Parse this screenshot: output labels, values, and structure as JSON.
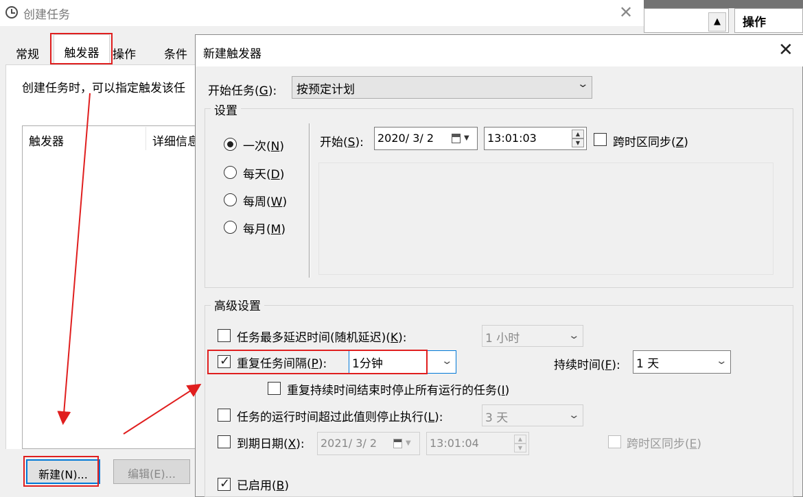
{
  "background_window": {
    "title": "创建任务",
    "close_glyph": "✕",
    "tabs": [
      "常规",
      "触发器",
      "操作",
      "条件"
    ],
    "description": "创建任务时，可以指定触发该任",
    "list_columns": [
      "触发器",
      "详细信息"
    ],
    "buttons": {
      "new": "新建(N)...",
      "edit": "编辑(E)..."
    }
  },
  "right_panel": {
    "actions_header": "操作",
    "scroll_up_glyph": "▲"
  },
  "dialog": {
    "title": "新建触发器",
    "close_glyph": "✕",
    "begin_task": {
      "label": "开始任务(",
      "key": "G",
      "suffix": "):",
      "value": "按预定计划"
    },
    "settings": {
      "legend": "设置",
      "schedule_options": [
        {
          "text": "一次(",
          "key": "N",
          "suffix": ")",
          "selected": true
        },
        {
          "text": "每天(",
          "key": "D",
          "suffix": ")",
          "selected": false
        },
        {
          "text": "每周(",
          "key": "W",
          "suffix": ")",
          "selected": false
        },
        {
          "text": "每月(",
          "key": "M",
          "suffix": ")",
          "selected": false
        }
      ],
      "start": {
        "label": "开始(",
        "key": "S",
        "suffix": "):",
        "date": "2020/ 3/ 2",
        "time": "13:01:03"
      },
      "sync_timezone": {
        "label": "跨时区同步(",
        "key": "Z",
        "suffix": ")",
        "checked": false
      }
    },
    "advanced": {
      "legend": "高级设置",
      "delay": {
        "label": "任务最多延迟时间(随机延迟)(",
        "key": "K",
        "suffix": "):",
        "checked": false,
        "value": "1 小时"
      },
      "repeat": {
        "label": "重复任务间隔(",
        "key": "P",
        "suffix": "):",
        "checked": true,
        "value": "1分钟",
        "duration_label": "持续时间(",
        "duration_key": "F",
        "duration_suffix": "):",
        "duration_value": "1 天"
      },
      "stop_running": {
        "label": "重复持续时间结束时停止所有运行的任务(",
        "key": "I",
        "suffix": ")",
        "checked": false
      },
      "stop_if_runs": {
        "label": "任务的运行时间超过此值则停止执行(",
        "key": "L",
        "suffix": "):",
        "checked": false,
        "value": "3 天"
      },
      "expire": {
        "label": "到期日期(",
        "key": "X",
        "suffix": "):",
        "checked": false,
        "date": "2021/ 3/ 2",
        "time": "13:01:04",
        "sync_label": "跨时区同步(",
        "sync_key": "E",
        "sync_suffix": ")"
      },
      "enabled": {
        "label": "已启用(",
        "key": "B",
        "suffix": ")",
        "checked": true
      }
    }
  },
  "colors": {
    "annotation": "#e01e1e",
    "focus_blue": "#0078d7"
  }
}
